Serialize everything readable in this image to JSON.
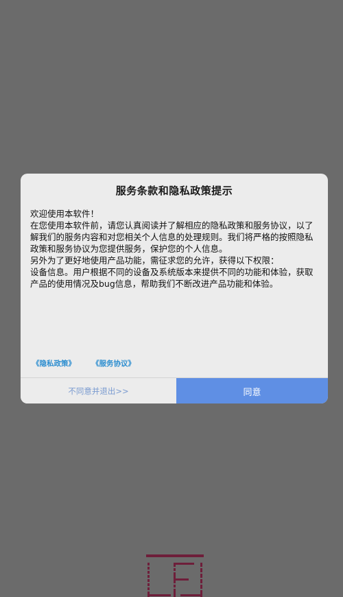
{
  "dialog": {
    "title": "服务条款和隐私政策提示",
    "paragraphs": [
      "欢迎使用本软件！",
      "在您使用本软件前，请您认真阅读并了解相应的隐私政策和服务协议，以了解我们的服务内容和对您相关个人信息的处理规则。我们将严格的按照隐私政策和服务协议为您提供服务，保护您的个人信息。",
      "另外为了更好地使用产品功能，需征求您的允许，获得以下权限：",
      "设备信息。用户根据不同的设备及系统版本来提供不同的功能和体验，获取产品的使用情况及bug信息，帮助我们不断改进产品功能和体验。"
    ],
    "links": {
      "privacy_policy": "《隐私政策》",
      "service_agreement": "《服务协议》"
    },
    "buttons": {
      "decline": "不同意并退出>>",
      "agree": "同意"
    }
  },
  "colors": {
    "backdrop": "#6b6b6b",
    "dialog_bg": "#ececec",
    "link": "#2f8fd0",
    "agree_bg": "#5f8fe4",
    "decline_text": "#7a9bd0",
    "logo": "#6e1e3a"
  },
  "icons": {
    "bottom_logo": "app-logo"
  }
}
